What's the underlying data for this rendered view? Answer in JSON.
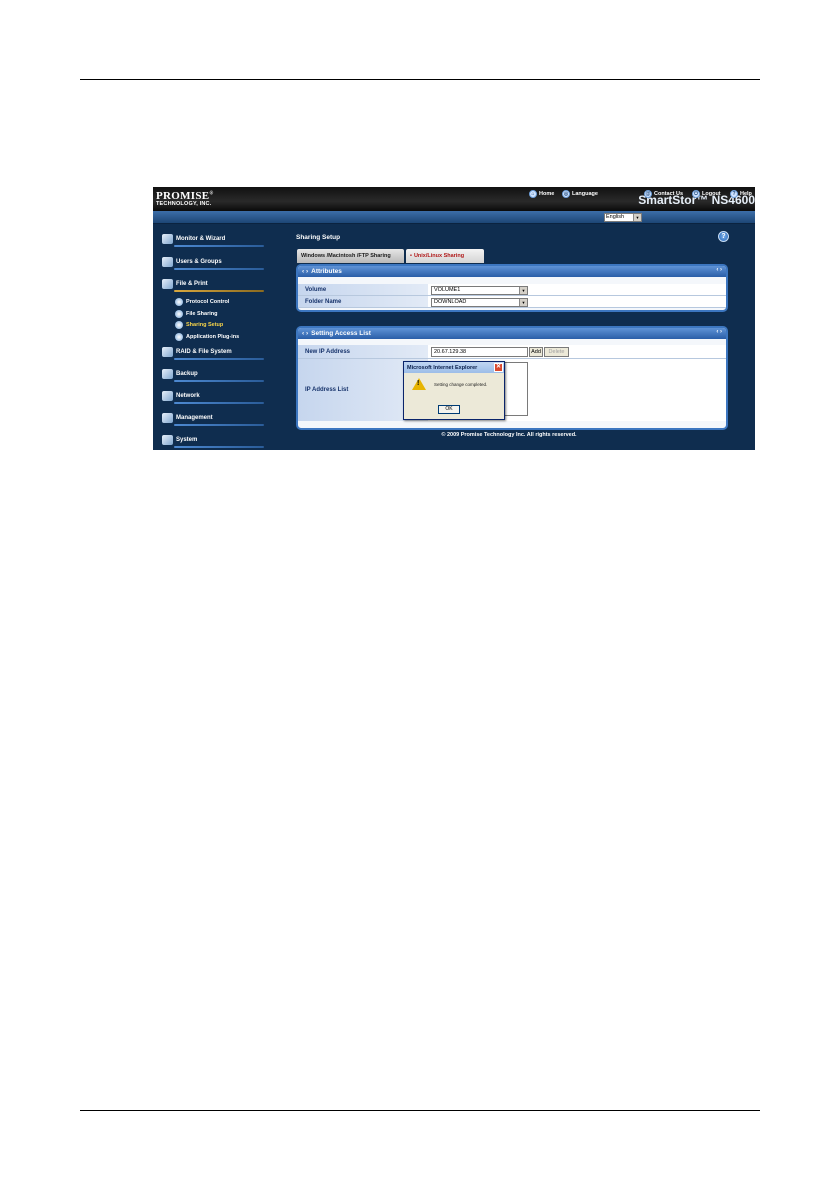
{
  "banner": {
    "logo_line1": "PROMISE",
    "logo_mark": "®",
    "logo_line2": "TECHNOLOGY, INC.",
    "product": "SmartStor™ NS4600"
  },
  "toolbar": {
    "home": "Home",
    "language": "Language",
    "language_value": "English",
    "contact": "Contact Us",
    "logout": "Logout",
    "help": "Help"
  },
  "sidebar": {
    "items": [
      {
        "label": "Monitor & Wizard",
        "icon": "monitor-icon"
      },
      {
        "label": "Users & Groups",
        "icon": "users-icon"
      },
      {
        "label": "File & Print",
        "icon": "folder-icon"
      },
      {
        "label": "RAID & File System",
        "icon": "raid-icon"
      },
      {
        "label": "Backup",
        "icon": "backup-icon"
      },
      {
        "label": "Network",
        "icon": "network-icon"
      },
      {
        "label": "Management",
        "icon": "management-icon"
      },
      {
        "label": "System",
        "icon": "system-icon"
      }
    ],
    "subitems": [
      {
        "label": "Protocol Control"
      },
      {
        "label": "File Sharing"
      },
      {
        "label": "Sharing Setup"
      },
      {
        "label": "Application Plug-ins"
      }
    ]
  },
  "main": {
    "title": "Sharing Setup",
    "help_glyph": "?",
    "tabs": [
      {
        "label": "Windows /Macintosh /FTP Sharing"
      },
      {
        "label": "Unix/Linux Sharing",
        "prefix": "•"
      }
    ],
    "attributes": {
      "header": "Attributes",
      "volume_label": "Volume",
      "volume_value": "VOLUME1",
      "folder_label": "Folder Name",
      "folder_value": "DOWNLOAD"
    },
    "access": {
      "header": "Setting Access List",
      "new_ip_label": "New IP Address",
      "new_ip_value": "20.67.129.38",
      "add_button": "Add",
      "delete_button": "Delete",
      "ip_list_label": "IP Address List"
    },
    "header_dots": "‹ ›",
    "copyright": "© 2009 Promise Technology Inc. All rights reserved."
  },
  "dialog": {
    "title": "Microsoft Internet Explorer",
    "message": "Setting change completed.",
    "ok": "OK",
    "close_glyph": "✕"
  },
  "colors": {
    "page_bg": "#0f2d4f",
    "panel_header": "#2a5ea8",
    "active_tab_text": "#b01818",
    "active_nav": "#f7d44a"
  }
}
